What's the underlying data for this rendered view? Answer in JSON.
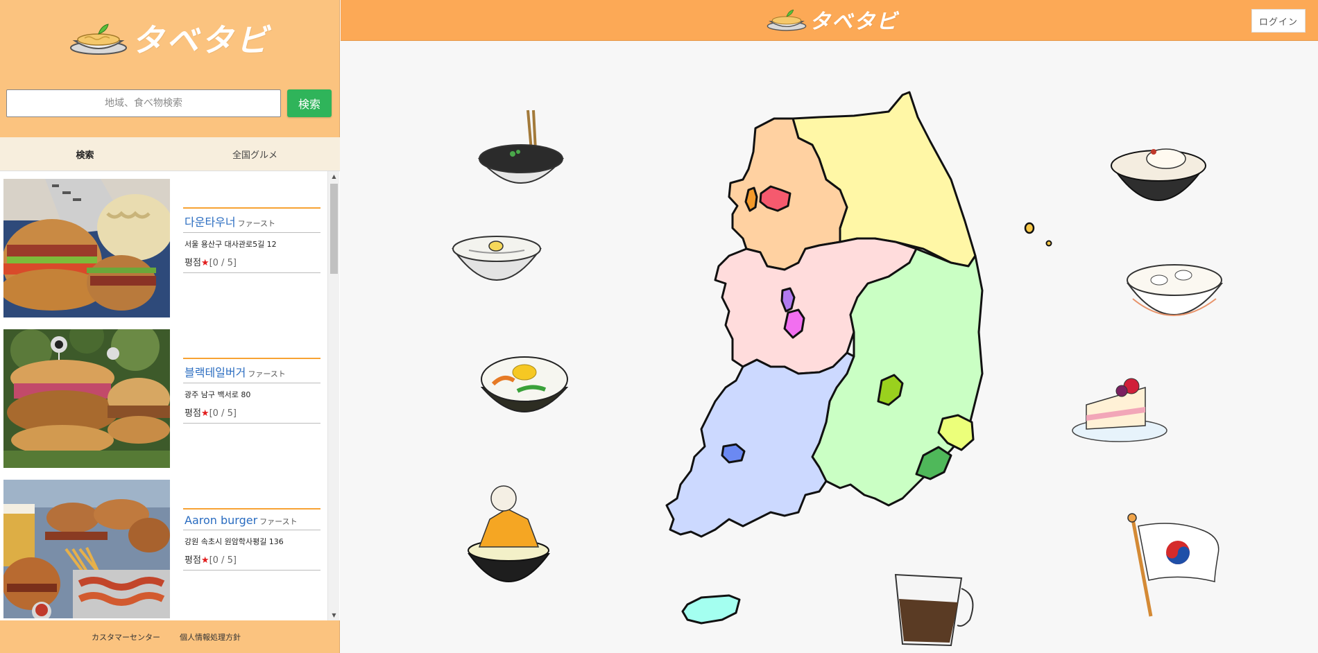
{
  "brand": {
    "logo_text": "タベタビ"
  },
  "search": {
    "placeholder": "地域、食べ物検索",
    "button_label": "検索"
  },
  "tabs": [
    {
      "label": "検索",
      "active": true
    },
    {
      "label": "全国グルメ",
      "active": false
    }
  ],
  "results": [
    {
      "name": "다운타우너",
      "category": "ファースト",
      "address": "서울 용산구 대사관로5길 12",
      "rating_label": "평점",
      "rating_value": "[0 / 5]"
    },
    {
      "name": "블랙테일버거",
      "category": "ファースト",
      "address": "광주 남구 백서로 80",
      "rating_label": "평점",
      "rating_value": "[0 / 5]"
    },
    {
      "name": "Aaron burger",
      "category": "ファースト",
      "address": "강원 속초시 원암학사평길 136",
      "rating_label": "평점",
      "rating_value": "[0 / 5]"
    }
  ],
  "footer": {
    "customer_center": "カスタマーセンター",
    "privacy": "個人情報処理方針"
  },
  "header": {
    "login_label": "ログイン"
  },
  "colors": {
    "sidebar": "#fbc37f",
    "header": "#fca956",
    "accent_green": "#2fb45a",
    "link_blue": "#2a6cc0",
    "star_red": "#e21d1d"
  }
}
